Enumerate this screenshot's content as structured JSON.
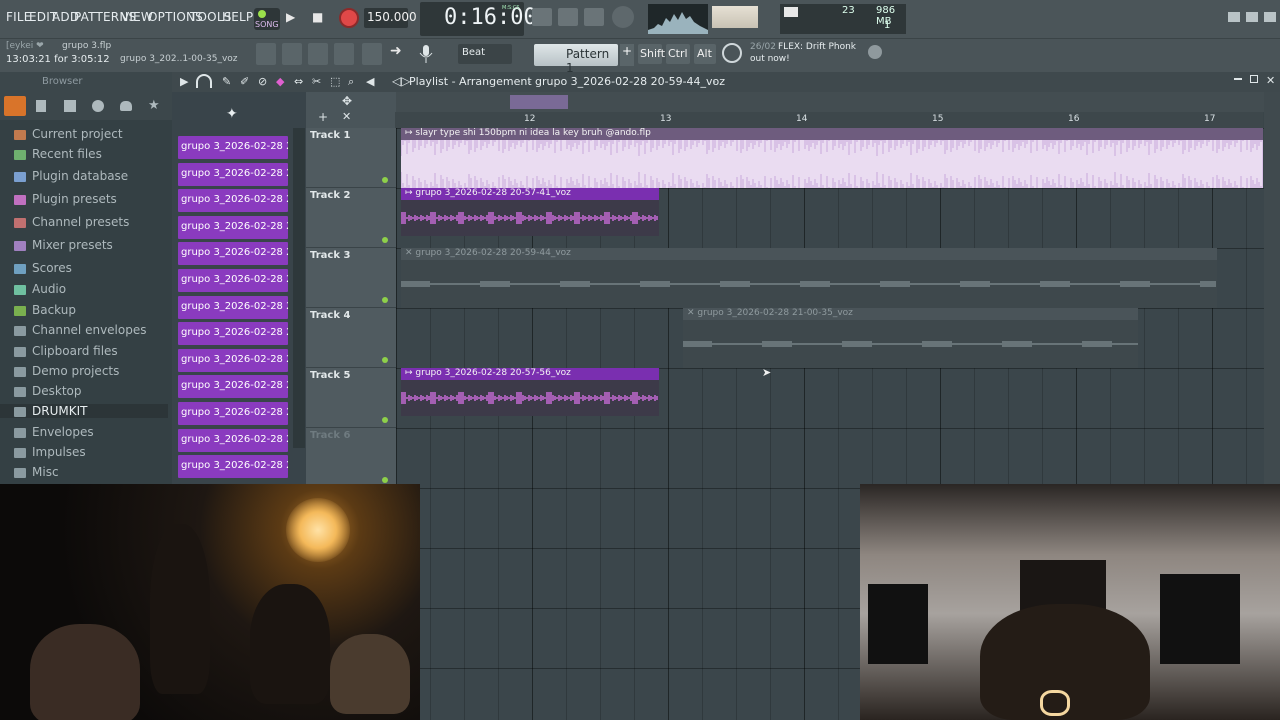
{
  "menu": {
    "items": [
      "FILE",
      "EDIT",
      "ADD",
      "PATTERNS",
      "VIEW",
      "OPTIONS",
      "TOOLS",
      "HELP"
    ]
  },
  "transport": {
    "mode": "SONG",
    "tempo": "150.000",
    "time": "0:16:00",
    "time_unit": "M:S:CS",
    "cpu": "23",
    "memory": "986 MB",
    "polyphony": "1"
  },
  "project": {
    "user": "[eykei ❤",
    "file": "grupo 3.flp",
    "time_info": "13:03:21 for 3:05:12",
    "clip_name": "grupo 3_202..1-00-35_voz"
  },
  "toolbar2": {
    "snap": "Beat",
    "pattern": "Pattern 1",
    "keys": [
      "Shift",
      "Ctrl",
      "Alt"
    ],
    "news_date": "26/02",
    "news_text": "FLEX: Drift Phonk",
    "news_text2": "out now!"
  },
  "browser": {
    "title": "Browser",
    "items": [
      {
        "label": "Current project",
        "color": "#c27a4e"
      },
      {
        "label": "Recent files",
        "color": "#6fb06f"
      },
      {
        "label": "Plugin database",
        "color": "#7a9fd0"
      },
      {
        "label": "Plugin presets",
        "color": "#c070c0"
      },
      {
        "label": "Channel presets",
        "color": "#c07070"
      },
      {
        "label": "Mixer presets",
        "color": "#a080c0"
      },
      {
        "label": "Scores",
        "color": "#6fa0c0"
      },
      {
        "label": "Audio",
        "color": "#6fc0a0"
      },
      {
        "label": "Backup",
        "color": "#7ab04f"
      },
      {
        "label": "Channel envelopes",
        "color": "#8a9aa0"
      },
      {
        "label": "Clipboard files",
        "color": "#8a9aa0"
      },
      {
        "label": "Demo projects",
        "color": "#8a9aa0"
      },
      {
        "label": "Desktop",
        "color": "#8a9aa0"
      },
      {
        "label": "DRUMKIT",
        "color": "#8a9aa0"
      },
      {
        "label": "Envelopes",
        "color": "#8a9aa0"
      },
      {
        "label": "Impulses",
        "color": "#8a9aa0"
      },
      {
        "label": "Misc",
        "color": "#8a9aa0"
      }
    ]
  },
  "picker": {
    "clips": [
      "grupo 3_2026-02-28 20-...",
      "grupo 3_2026-02-28 20-...",
      "grupo 3_2026-02-28 20-...",
      "grupo 3_2026-02-28 20-...",
      "grupo 3_2026-02-28 20-...",
      "grupo 3_2026-02-28 20-...",
      "grupo 3_2026-02-28 20-...",
      "grupo 3_2026-02-28 20-...",
      "grupo 3_2026-02-28 20-...",
      "grupo 3_2026-02-28 20-...",
      "grupo 3_2026-02-28 20-...",
      "grupo 3_2026-02-28 20-...",
      "grupo 3_2026-02-28 20-..."
    ]
  },
  "playlist": {
    "title": "Playlist - Arrangement",
    "breadcrumb": "grupo 3_2026-02-28 20-59-44_voz",
    "ruler": [
      "12",
      "13",
      "14",
      "15",
      "16",
      "17"
    ],
    "tracks": [
      "Track 1",
      "Track 2",
      "Track 3",
      "Track 4",
      "Track 5",
      "Track 6"
    ],
    "clips": [
      {
        "label": "slayr type shi 150bpm ni idea la key bruh @ando.flp"
      },
      {
        "label": "grupo 3_2026-02-28 20-57-41_voz"
      },
      {
        "label": "grupo 3_2026-02-28 20-59-44_voz"
      },
      {
        "label": "grupo 3_2026-02-28 21-00-35_voz"
      },
      {
        "label": "grupo 3_2026-02-28 20-57-56_voz"
      }
    ]
  },
  "colors": {
    "accent": "#8a3bbf",
    "clip_audio": "#d7b9e3",
    "led": "#8ed04a"
  }
}
